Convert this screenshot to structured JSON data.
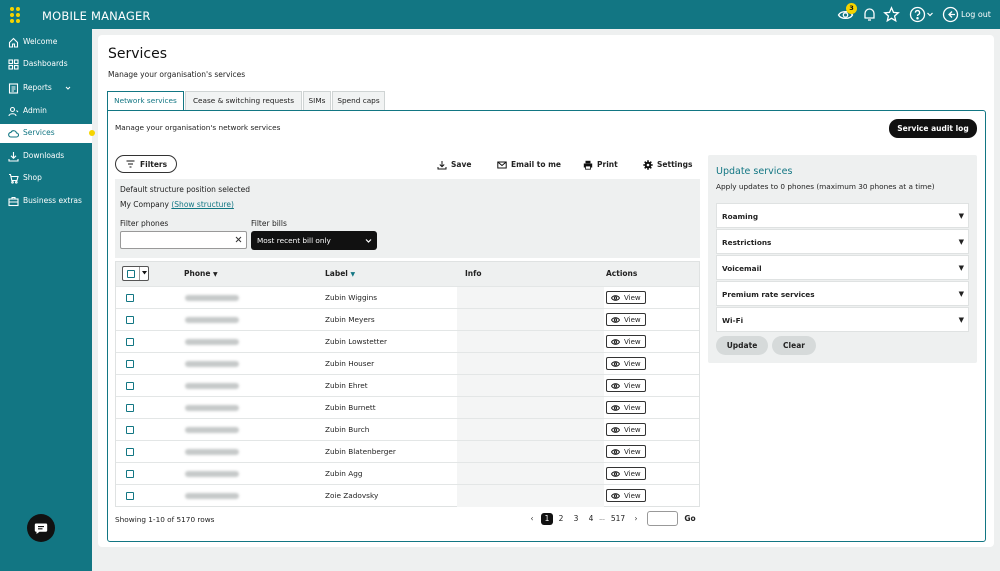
{
  "app": {
    "title": "MOBILE MANAGER"
  },
  "header": {
    "notification_count": "3",
    "logout_label": "Log out"
  },
  "colors": {
    "brand": "#127683",
    "accent": "#f5d400",
    "dark": "#111111"
  },
  "sidebar": {
    "items": [
      {
        "label": "Welcome",
        "icon": "home-icon"
      },
      {
        "label": "Dashboards",
        "icon": "grid-icon"
      },
      {
        "label": "Reports",
        "icon": "reports-icon"
      },
      {
        "label": "Admin",
        "icon": "admin-icon"
      },
      {
        "label": "Services",
        "icon": "cloud-icon",
        "active": true
      },
      {
        "label": "Downloads",
        "icon": "download-icon"
      },
      {
        "label": "Shop",
        "icon": "cart-icon"
      },
      {
        "label": "Business extras",
        "icon": "briefcase-icon"
      }
    ]
  },
  "page": {
    "title": "Services",
    "subtitle": "Manage your organisation's services"
  },
  "tabs": [
    {
      "label": "Network services",
      "active": true
    },
    {
      "label": "Cease & switching requests"
    },
    {
      "label": "SIMs"
    },
    {
      "label": "Spend caps"
    }
  ],
  "panel": {
    "description": "Manage your organisation's network services",
    "audit_button": "Service audit log",
    "filters_button": "Filters",
    "actions": {
      "save": "Save",
      "email": "Email to me",
      "print": "Print",
      "settings": "Settings"
    }
  },
  "filter": {
    "structure_heading": "Default structure position selected",
    "company": "My Company",
    "show_structure": "(Show structure)",
    "phones_label": "Filter phones",
    "phones_value": "",
    "bills_label": "Filter bills",
    "bills_value": "Most recent bill only"
  },
  "table": {
    "columns": {
      "phone": "Phone",
      "label": "Label",
      "info": "Info",
      "actions": "Actions"
    },
    "view_label": "View",
    "rows": [
      {
        "label": "Zubin Wiggins"
      },
      {
        "label": "Zubin Meyers"
      },
      {
        "label": "Zubin Lowstetter"
      },
      {
        "label": "Zubin Houser"
      },
      {
        "label": "Zubin Ehret"
      },
      {
        "label": "Zubin Burnett"
      },
      {
        "label": "Zubin Burch"
      },
      {
        "label": "Zubin Blatenberger"
      },
      {
        "label": "Zubin Agg"
      },
      {
        "label": "Zoie Zadovsky"
      }
    ]
  },
  "pagination": {
    "summary": "Showing 1-10 of 5170 rows",
    "prev": "‹",
    "next": "›",
    "pages": [
      "1",
      "2",
      "3",
      "4"
    ],
    "ellipsis": "...",
    "last": "517",
    "current": 1,
    "go": "Go"
  },
  "update_services": {
    "title": "Update services",
    "subtitle": "Apply updates to 0 phones (maximum 30 phones at a time)",
    "sections": [
      "Roaming",
      "Restrictions",
      "Voicemail",
      "Premium rate services",
      "Wi-Fi"
    ],
    "update_button": "Update",
    "clear_button": "Clear"
  }
}
